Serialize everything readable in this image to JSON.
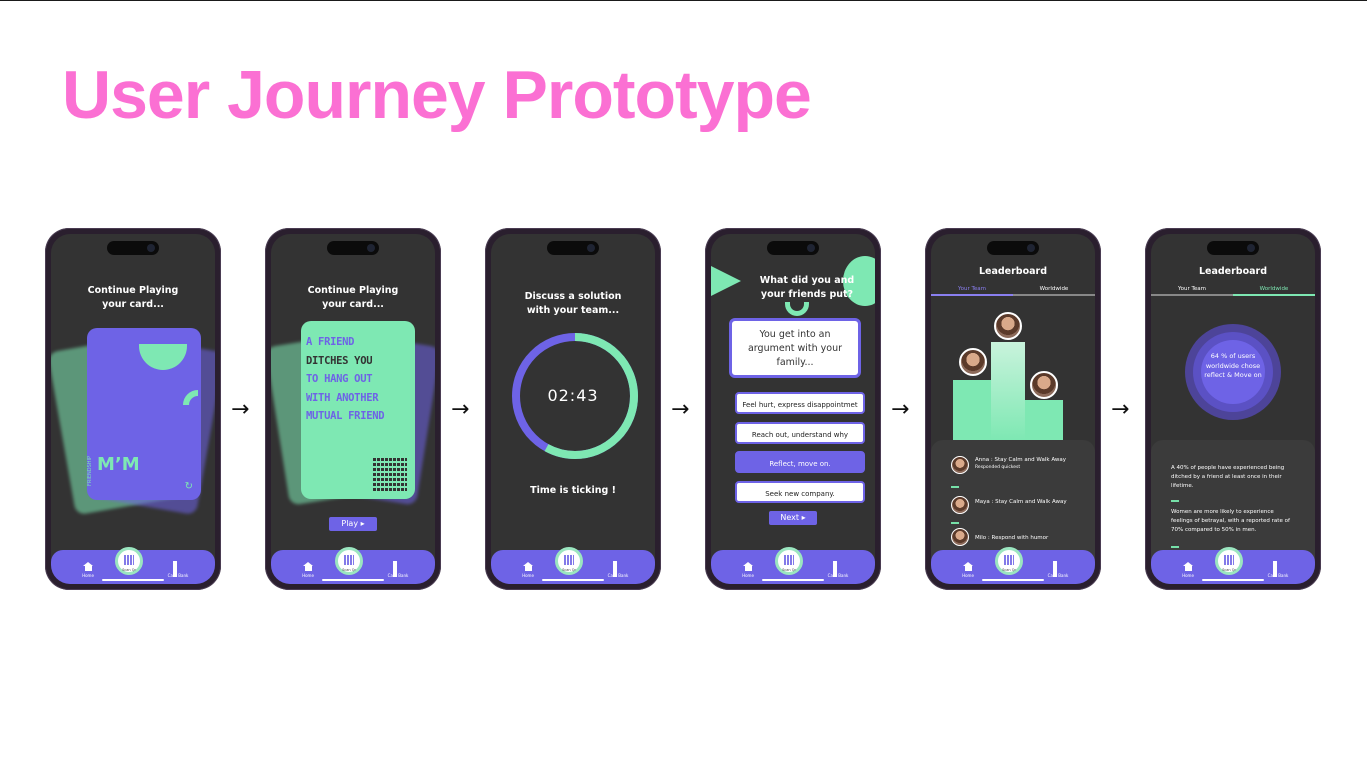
{
  "title": "User Journey Prototype",
  "arrow_glyph": "→",
  "nav": {
    "home": "Home",
    "scan": "Scan Qr",
    "cardbank": "Card Bank"
  },
  "screen1": {
    "heading_l1": "Continue Playing",
    "heading_l2": "your card...",
    "logo": "M’M",
    "logo_small": "FRIENDSHIP"
  },
  "screen2": {
    "heading_l1": "Continue Playing",
    "heading_l2": "your card...",
    "card_lines": [
      "A FRIEND",
      "DITCHES YOU",
      "TO HANG OUT",
      "WITH ANOTHER",
      "MUTUAL FRIEND"
    ],
    "play": "Play ▸"
  },
  "screen3": {
    "heading_l1": "Discuss a solution",
    "heading_l2": "with your team...",
    "timer": "02:43",
    "footer": "Time is ticking !",
    "progress": 0.58
  },
  "screen4": {
    "heading_l1": "What did you and",
    "heading_l2": "your friends put?",
    "prompt": "You get into an argument with your family...",
    "choices": [
      "Feel hurt, express disappointmet",
      "Reach out, understand why",
      "Reflect, move on.",
      "Seek new company."
    ],
    "selected_index": 2,
    "next": "Next ▸"
  },
  "screen5": {
    "heading": "Leaderboard",
    "tabs": [
      "Your Team",
      "Worldwide"
    ],
    "active_tab": 0,
    "rows": [
      {
        "text": "Anna : Stay Calm and Walk Away",
        "sub": "Responded quickest"
      },
      {
        "text": "Maya : Stay Calm and Walk Away",
        "sub": ""
      },
      {
        "text": "Milo : Respond with humor",
        "sub": ""
      }
    ]
  },
  "screen6": {
    "heading": "Leaderboard",
    "tabs": [
      "Your Team",
      "Worldwide"
    ],
    "active_tab": 1,
    "stat": "64 %  of users worldwide chose reflect & Move on",
    "facts": [
      "A 40% of people have experienced being ditched by a friend at least once in their lifetime.",
      "Women are more likely to experience feelings of betrayal, with a reported rate of 70% compared to 50% in men."
    ]
  },
  "colors": {
    "accent": "#6e63e6",
    "mint": "#7ee8b3",
    "title": "#fb70d3",
    "screen": "#333333"
  }
}
